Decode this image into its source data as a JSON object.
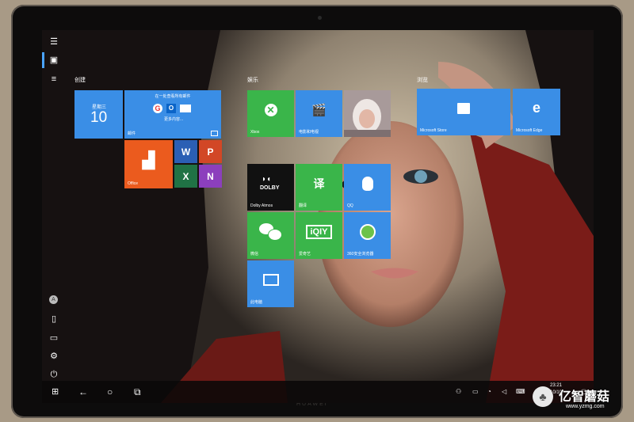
{
  "device": {
    "brand": "HUAWEI"
  },
  "start": {
    "groups": [
      {
        "label": "创建"
      },
      {
        "label": "娱乐"
      },
      {
        "label": "浏览"
      }
    ],
    "calendar": {
      "weekday": "星期三",
      "day": "10"
    },
    "mail": {
      "header": "在一处查看所有邮件",
      "sub": "更多内容...",
      "label": "邮件"
    },
    "tiles": {
      "office": "Office",
      "xbox": "Xbox",
      "movies": "电影和电视",
      "store": "Microsoft Store",
      "edge": "Microsoft Edge",
      "dolby": "Dolby Atmos",
      "dolby_logo": "DOLBY",
      "translate": "翻译",
      "qq": "QQ",
      "wechat": "微信",
      "iqiyi": "爱奇艺",
      "iqiyi_logo": "iQIY",
      "security": "360安全浏览器",
      "pcmanager": "此电脑"
    }
  },
  "taskbar": {
    "time": "23:21",
    "date": "2018/10/10"
  },
  "watermark": {
    "name": "亿智蘑菇",
    "url": "www.yzmg.com"
  },
  "colors": {
    "accent": "#3a8ee6",
    "green": "#3ab54a",
    "office": "#eb5b1e"
  }
}
